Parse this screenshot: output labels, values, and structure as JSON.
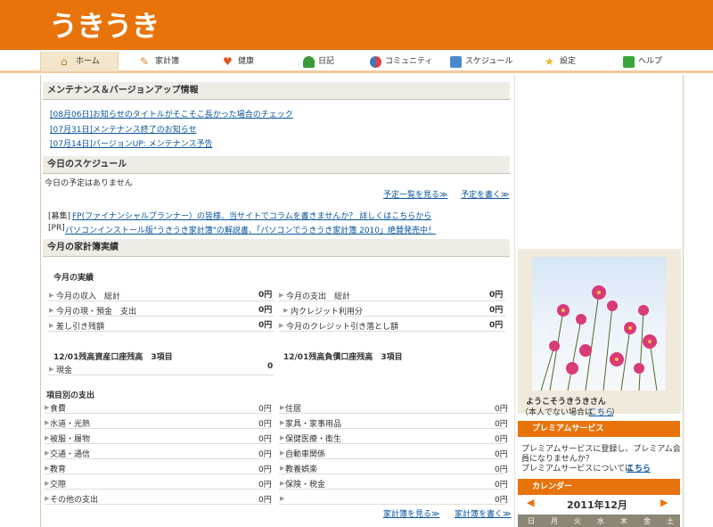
{
  "app": {
    "logo": "うきうき"
  },
  "nav": {
    "items": [
      {
        "label": "ホーム",
        "icon": "home-icon"
      },
      {
        "label": "家計簿",
        "icon": "pencil-icon"
      },
      {
        "label": "健康",
        "icon": "heart-icon"
      },
      {
        "label": "日記",
        "icon": "person-icon"
      },
      {
        "label": "コミュニティ",
        "icon": "community-icon"
      },
      {
        "label": "スケジュール",
        "icon": "calendar-icon"
      },
      {
        "label": "設定",
        "icon": "star-icon"
      },
      {
        "label": "ヘルプ",
        "icon": "help-icon"
      }
    ]
  },
  "maintenance": {
    "title": "メンテナンス＆バージョンアップ情報",
    "items": [
      "[08月06日]お知らせのタイトルがそこそこ長かった場合のチェック",
      "[07月31日]メンテナンス終了のお知らせ",
      "[07月14日]バージョンUP: メンテナンス予告"
    ]
  },
  "schedule": {
    "title": "今日のスケジュール",
    "empty": "今日の予定はありません",
    "view_link": "予定一覧を見る≫",
    "write_link": "予定を書く≫",
    "notices": [
      {
        "prefix": "[募集]",
        "text": "FP(ファイナンシャルプランナー）の皆様、当サイトでコラムを書きませんか？ 詳しくはこちらから"
      },
      {
        "prefix": "[PR]",
        "text": "パソコンインストール版\"うきうき家計簿\"の解説書、「パソコンでうきうき家計簿 2010」絶賛発売中！"
      }
    ]
  },
  "kakeibo": {
    "title": "今月の家計簿実績",
    "results_title": "今月の実績",
    "left_rows": [
      {
        "label": "今月の収入　総計",
        "value": "0円"
      },
      {
        "label": "今月の現・預金　支出",
        "value": "0円"
      },
      {
        "label": "差し引き残額",
        "value": "0円"
      }
    ],
    "right_rows": [
      {
        "label": "今月の支出　総計",
        "value": "0円"
      },
      {
        "label": "内クレジット利用分",
        "value": "0円"
      },
      {
        "label": "今月のクレジット引き落とし額",
        "value": "0円"
      }
    ],
    "assets_title": "12/01残高資産口座残高　3項目",
    "assets_rows": [
      {
        "label": "現金",
        "value": "0"
      }
    ],
    "liab_title": "12/01残高負債口座残高　3項目",
    "category_title": "項目別の支出",
    "categories_left": [
      {
        "label": "食費",
        "value": "0円"
      },
      {
        "label": "水道・光熱",
        "value": "0円"
      },
      {
        "label": "被服・履物",
        "value": "0円"
      },
      {
        "label": "交通・通信",
        "value": "0円"
      },
      {
        "label": "教育",
        "value": "0円"
      },
      {
        "label": "交際",
        "value": "0円"
      },
      {
        "label": "その他の支出",
        "value": "0円"
      }
    ],
    "categories_right": [
      {
        "label": "住居",
        "value": "0円"
      },
      {
        "label": "家具・家事用品",
        "value": "0円"
      },
      {
        "label": "保健医療・衛生",
        "value": "0円"
      },
      {
        "label": "自動車関係",
        "value": "0円"
      },
      {
        "label": "教養娯楽",
        "value": "0円"
      },
      {
        "label": "保険・税金",
        "value": "0円"
      },
      {
        "label": "",
        "value": "0円"
      }
    ],
    "view_link": "家計簿を見る≫",
    "write_link": "家計簿を書く≫"
  },
  "sidebar": {
    "welcome": "ようこそうきうきさん",
    "not_you_prefix": "（本人でない場合は",
    "not_you_link": "こちら",
    "not_you_suffix": "）",
    "premium_title": "プレミアムサービス",
    "premium_text1": "プレミアムサービスに登録し、プレミアム会",
    "premium_text2": "員になりませんか？",
    "premium_text3": "プレミアムサービスについては",
    "premium_link": "こちら",
    "calendar_title": "カレンダー",
    "calendar_month": "2011年12月",
    "weekdays": [
      "日",
      "月",
      "火",
      "水",
      "木",
      "金",
      "土"
    ]
  },
  "colors": {
    "brand": "#e9730b",
    "link": "#0a55a0",
    "header_bg": "#efece6"
  }
}
